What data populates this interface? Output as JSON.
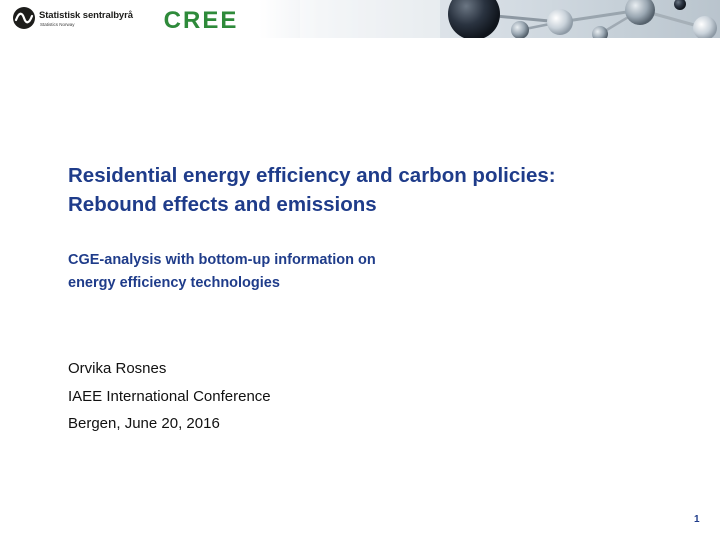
{
  "header": {
    "ssb_logo": {
      "name": "Statistisk sentralbyrå",
      "subname": "Statistics Norway"
    },
    "cree_logo": {
      "text": "CREE",
      "color": "#2e8a3a"
    },
    "decoration": "molecule-image"
  },
  "title": {
    "line1": "Residential energy efficiency and carbon policies:",
    "line2": "Rebound effects and emissions"
  },
  "subtitle": {
    "line1": "CGE-analysis with bottom-up information on",
    "line2": "energy efficiency technologies"
  },
  "author": {
    "name": "Orvika Rosnes",
    "event": "IAEE International Conference",
    "place_date": "Bergen, June 20, 2016"
  },
  "page_number": "1",
  "colors": {
    "title": "#1f3c8a",
    "body": "#111111",
    "logo_green": "#2e8a3a"
  }
}
